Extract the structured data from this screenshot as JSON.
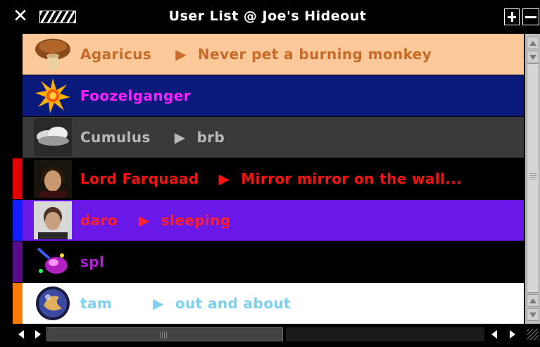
{
  "window": {
    "title": "User List @ Joe's Hideout"
  },
  "colors": {
    "agaricus_bg": "#fdc99b",
    "agaricus_fg": "#c86a28",
    "foozel_bg": "#0a1a7a",
    "foozel_fg": "#ff22ff",
    "cumulus_bg": "#3a3a3a",
    "cumulus_fg": "#b8b8b8",
    "farquaad_bg": "#000000",
    "farquaad_fg": "#ff1010",
    "daro_bg": "#6a18e8",
    "daro_fg": "#ff2030",
    "spl_bg": "#000000",
    "spl_fg": "#b020d0",
    "tam_bg": "#ffffff",
    "tam_fg": "#7fd0ee"
  },
  "users": [
    {
      "name": "Agaricus",
      "status": "Never pet a burning monkey",
      "avatar": "mushroom-icon"
    },
    {
      "name": "Foozelganger",
      "status": "",
      "avatar": "sunburst-icon"
    },
    {
      "name": "Cumulus",
      "status": "brb",
      "avatar": "cloud-icon"
    },
    {
      "name": "Lord Farquaad",
      "status": "Mirror mirror on the wall...",
      "avatar": "portrait-icon"
    },
    {
      "name": "daro",
      "status": "sleeping",
      "avatar": "portrait-icon"
    },
    {
      "name": "spl",
      "status": "",
      "avatar": "gem-icon"
    },
    {
      "name": "tam",
      "status": "out and about",
      "avatar": "orb-icon"
    }
  ],
  "glyphs": {
    "arrow": "▶",
    "close": "✕"
  }
}
